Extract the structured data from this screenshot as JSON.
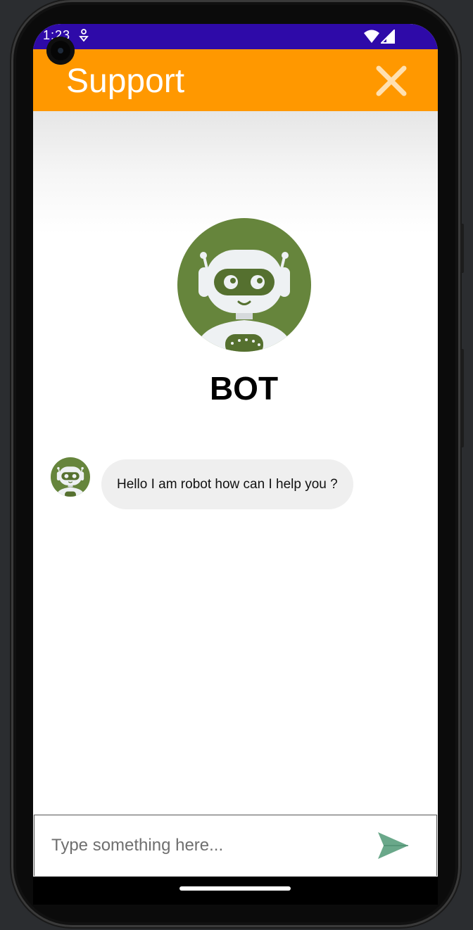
{
  "status_bar": {
    "time": "1:23",
    "bg_color": "#2e0aa8"
  },
  "app_bar": {
    "title": "Support",
    "close_icon": "close-icon",
    "bg_color": "#ff9800"
  },
  "bot_profile": {
    "name": "BOT",
    "avatar_icon": "robot-avatar-icon",
    "avatar_color": "#66853c"
  },
  "messages": [
    {
      "sender": "bot",
      "text": "Hello I am robot how can I help you ?"
    }
  ],
  "composer": {
    "placeholder": "Type something here...",
    "value": "",
    "send_icon": "send-icon",
    "send_color": "#6aa88a"
  }
}
